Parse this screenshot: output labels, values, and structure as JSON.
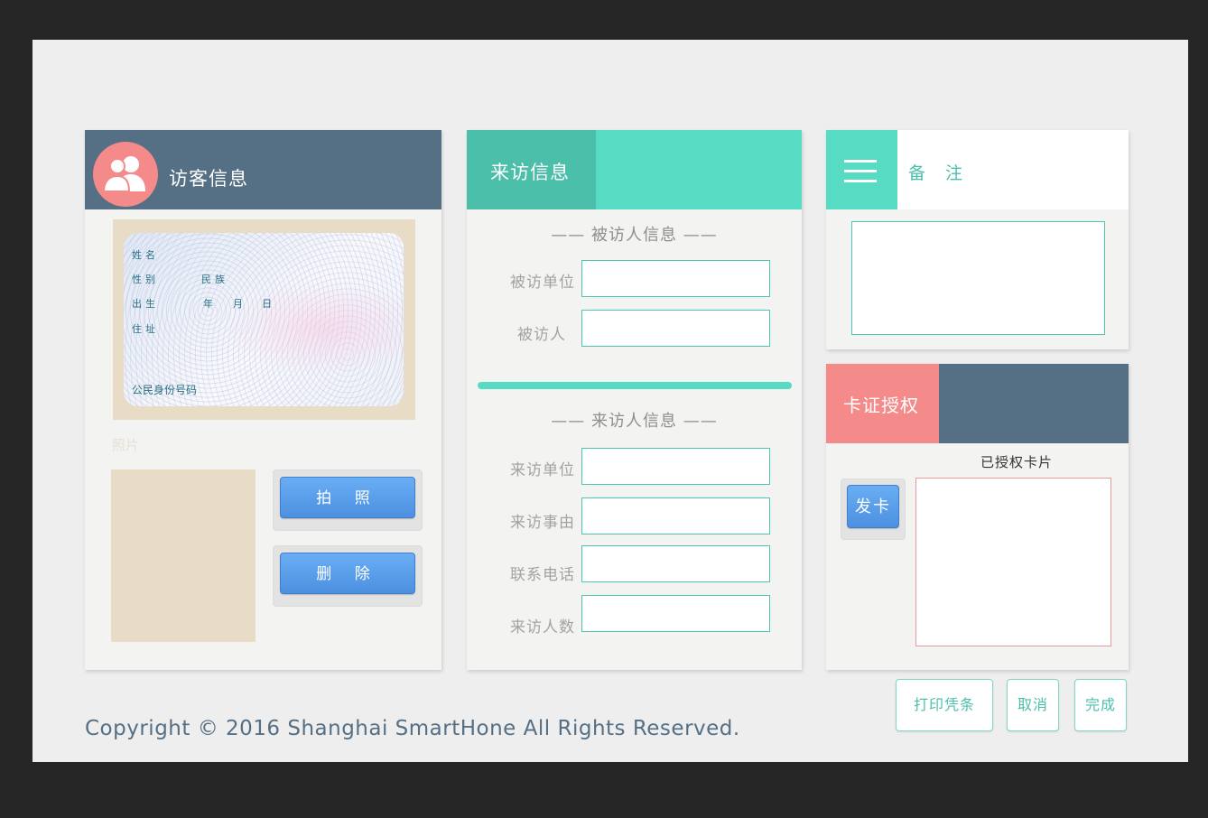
{
  "visitor_panel": {
    "title": "访客信息",
    "icon": "user-group-icon",
    "id_card": {
      "name_label": "姓名",
      "gender_label": "性别",
      "ethnicity_label": "民族",
      "birth_label": "出生",
      "year_label": "年",
      "month_label": "月",
      "day_label": "日",
      "address_label": "住址",
      "id_number_label": "公民身份号码"
    },
    "photo_label": "照片",
    "take_photo_button": "拍 照",
    "delete_button": "删 除"
  },
  "visit_panel": {
    "title": "来访信息",
    "host_section_title": "—— 被访人信息 ——",
    "host_unit_label": "被访单位",
    "host_person_label": "被访人",
    "visitor_section_title": "—— 来访人信息 ——",
    "visitor_unit_label": "来访单位",
    "visit_reason_label": "来访事由",
    "phone_label": "联系电话",
    "visitor_count_label": "来访人数"
  },
  "notes_panel": {
    "title": "备 注",
    "icon": "menu-icon"
  },
  "card_panel": {
    "title": "卡证授权",
    "authorized_cards_label": "已授权卡片",
    "issue_card_button": "发卡"
  },
  "actions": {
    "print_button": "打印凭条",
    "cancel_button": "取消",
    "done_button": "完成"
  },
  "footer": {
    "copyright": "Copyright © 2016 Shanghai SmartHone All Rights Reserved."
  },
  "colors": {
    "slate": "#556f85",
    "teal": "#57dbc2",
    "teal_dark": "#4cbfaa",
    "coral": "#f58a8a",
    "blue_button": "#5a9ee9",
    "beige": "#e8dcc6"
  }
}
